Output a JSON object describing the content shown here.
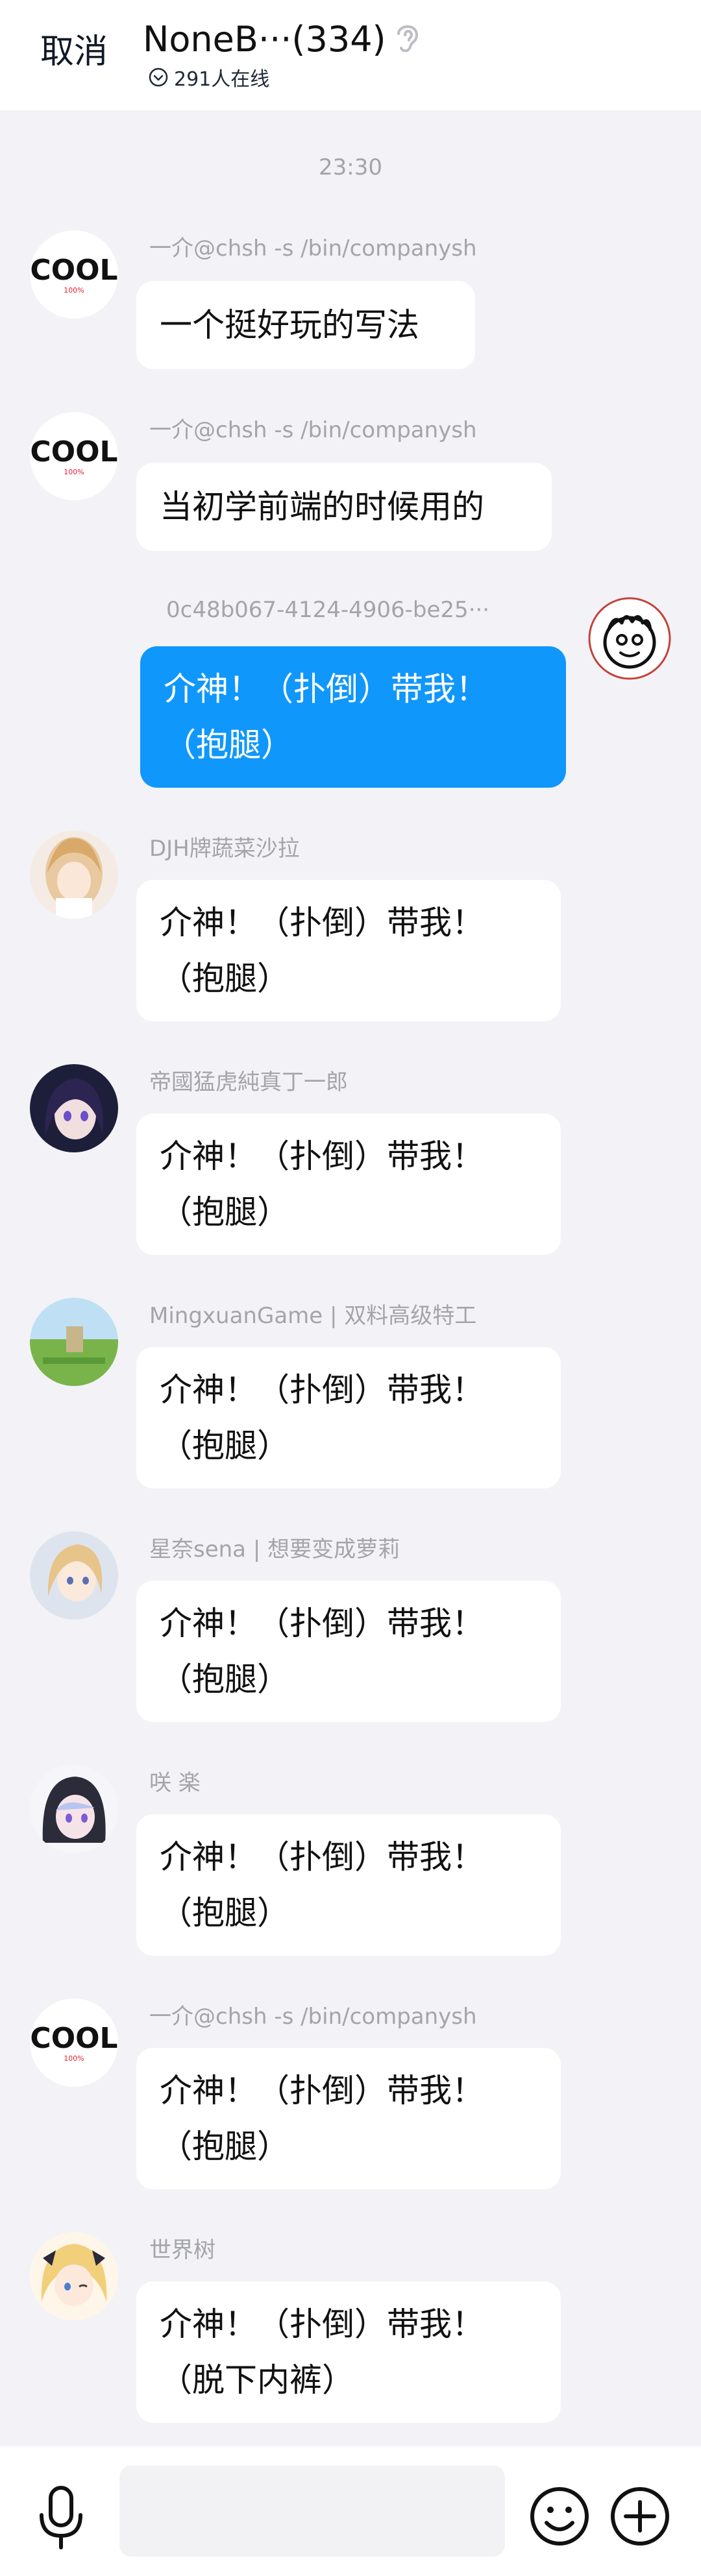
{
  "header": {
    "cancel_label": "取消",
    "title": "NoneB···(334)",
    "online": "291人在线"
  },
  "timestamp": "23:30",
  "messages": [
    {
      "sender": "一介@chsh -s /bin/companysh",
      "lines": [
        "一个挺好玩的写法"
      ],
      "avatar": "cool-logo-avatar"
    },
    {
      "sender": "一介@chsh -s /bin/companysh",
      "lines": [
        "当初学前端的时候用的"
      ],
      "avatar": "cool-logo-avatar"
    },
    {
      "sender": "0c48b067-4124-4906-be25···",
      "lines": [
        "介神！（扑倒）带我！",
        "（抱腿）"
      ],
      "avatar": "doodle-face-avatar",
      "self": true
    },
    {
      "sender": "DJH牌蔬菜沙拉",
      "lines": [
        "介神！（扑倒）带我！",
        "（抱腿）"
      ],
      "avatar": "anime-girl-avatar"
    },
    {
      "sender": "帝國猛虎純真丁一郎",
      "lines": [
        "介神！（扑倒）带我！",
        "（抱腿）"
      ],
      "avatar": "anime-dark-avatar"
    },
    {
      "sender": "MingxuanGame | 双料高级特工",
      "lines": [
        "介神！（扑倒）带我！",
        "（抱腿）"
      ],
      "avatar": "landscape-avatar"
    },
    {
      "sender": "星奈sena | 想要变成萝莉",
      "lines": [
        "介神！（扑倒）带我！",
        "（抱腿）"
      ],
      "avatar": "anime-light-avatar"
    },
    {
      "sender": "咲 楽",
      "lines": [
        "介神！（扑倒）带我！",
        "（抱腿）"
      ],
      "avatar": "anime-hood-avatar"
    },
    {
      "sender": "一介@chsh -s /bin/companysh",
      "lines": [
        "介神！（扑倒）带我！",
        "（抱腿）"
      ],
      "avatar": "cool-logo-avatar"
    },
    {
      "sender": "世界树",
      "lines": [
        "介神！（扑倒）带我！",
        "（脱下内裤）"
      ],
      "avatar": "anime-blonde-avatar"
    }
  ],
  "cool_logo": {
    "word": "COOL",
    "sub": "100%"
  },
  "colors": {
    "self_bubble": "#1097fb",
    "background": "#f2f2f7"
  }
}
